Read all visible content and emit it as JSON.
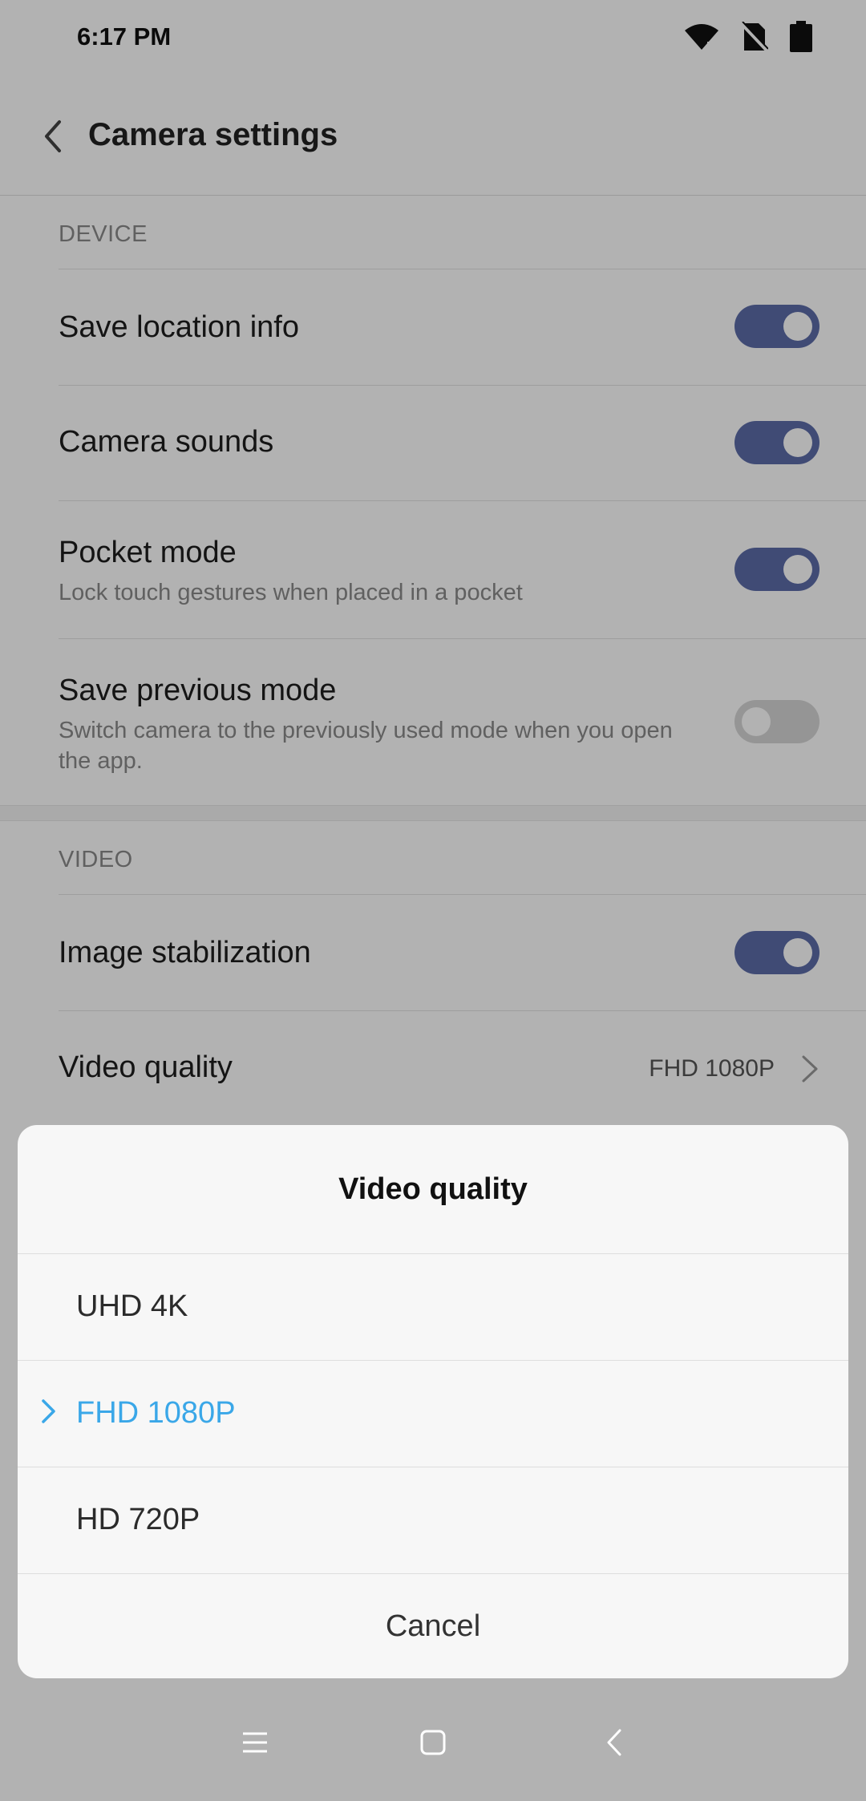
{
  "status": {
    "time": "6:17 PM",
    "icons": [
      "wifi-icon",
      "no-sim-icon",
      "battery-icon"
    ]
  },
  "app_bar": {
    "title": "Camera settings",
    "back_icon": "back-arrow-icon"
  },
  "sections": {
    "device": {
      "header": "DEVICE",
      "items": [
        {
          "title": "Save location info",
          "subtitle": "",
          "toggle": true
        },
        {
          "title": "Camera sounds",
          "subtitle": "",
          "toggle": true
        },
        {
          "title": "Pocket mode",
          "subtitle": "Lock touch gestures when placed in a pocket",
          "toggle": true
        },
        {
          "title": "Save previous mode",
          "subtitle": "Switch camera to the previously used mode when you open the app.",
          "toggle": false
        }
      ]
    },
    "video": {
      "header": "VIDEO",
      "items": [
        {
          "title": "Image stabilization",
          "toggle": true
        },
        {
          "title": "Video quality",
          "value": "FHD 1080P"
        }
      ]
    }
  },
  "dialog": {
    "title": "Video quality",
    "options": [
      {
        "label": "UHD 4K",
        "selected": false
      },
      {
        "label": "FHD 1080P",
        "selected": true
      },
      {
        "label": "HD 720P",
        "selected": false
      }
    ],
    "cancel_label": "Cancel"
  },
  "nav": {
    "icons": [
      "menu-icon",
      "home-icon",
      "back-icon"
    ]
  },
  "colors": {
    "accent": "#3aa7e8",
    "toggle_on": "#5c6ca8",
    "toggle_off": "#d6d6d6"
  }
}
